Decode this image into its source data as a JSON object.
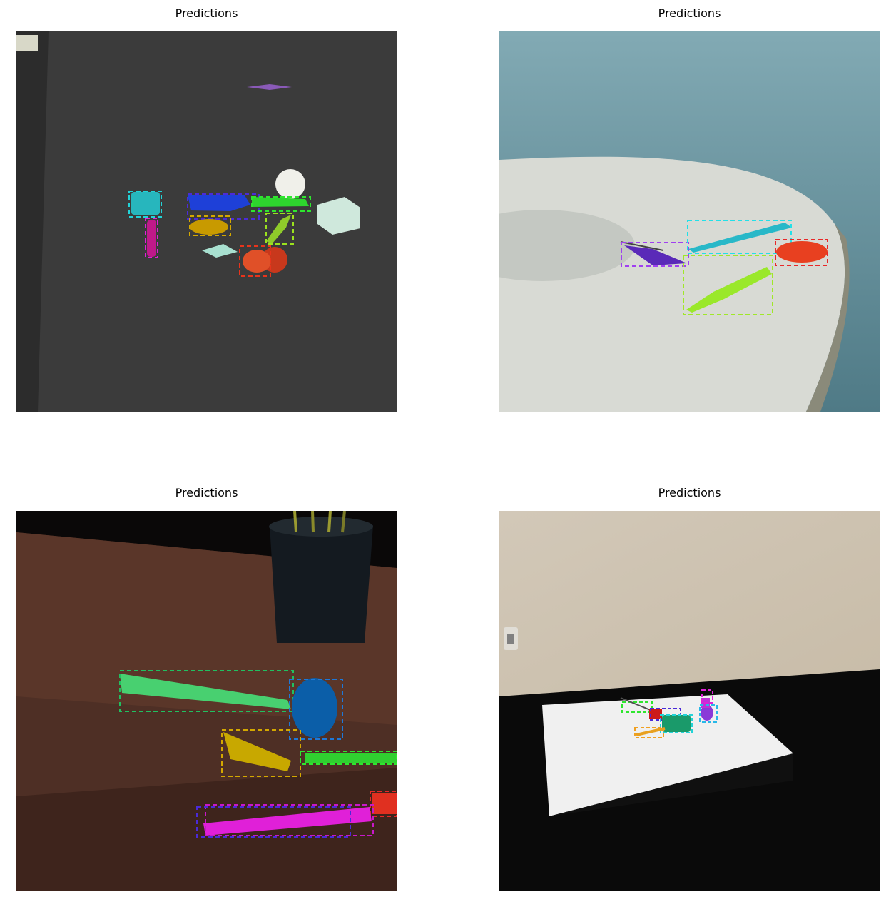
{
  "panels": [
    {
      "title": "Predictions",
      "scene": "dark wall with colored kitchen utensils, ball and cube"
    },
    {
      "title": "Predictions",
      "scene": "white round table with knife, spatula, brush and cutter"
    },
    {
      "title": "Predictions",
      "scene": "wooden table with plant pot and utensils"
    },
    {
      "title": "Predictions",
      "scene": "white box platform in a dark room with small utensils"
    }
  ],
  "colors": {
    "cyan": "#22d3d8",
    "blue": "#1e40d8",
    "green": "#2ee62e",
    "lime": "#9be21e",
    "yellow": "#d4a800",
    "red": "#e8341c",
    "magenta": "#e020d8",
    "purple": "#8a2be2"
  }
}
